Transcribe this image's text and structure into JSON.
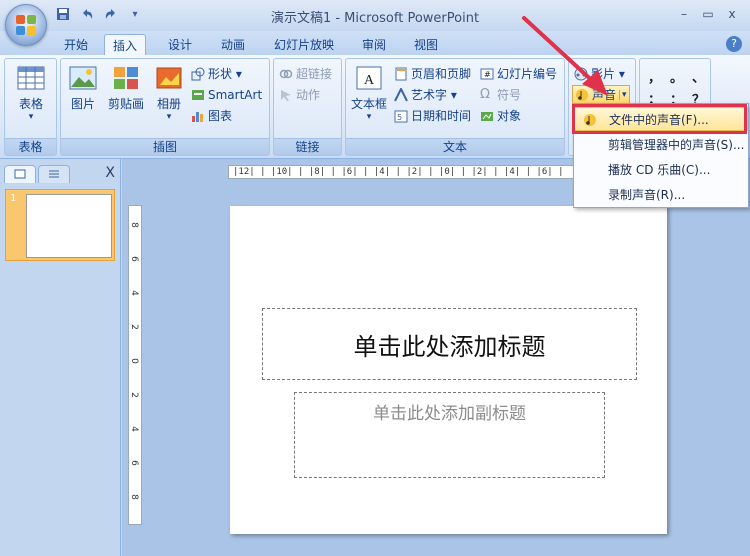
{
  "window": {
    "title": "演示文稿1 - Microsoft PowerPoint",
    "minimize": "–",
    "maximize": "▭",
    "close": "x"
  },
  "qat": {
    "save": "💾",
    "undo": "↶",
    "redo": "↷",
    "more": "▾"
  },
  "tabs": [
    "开始",
    "插入",
    "设计",
    "动画",
    "幻灯片放映",
    "审阅",
    "视图"
  ],
  "active_tab": "插入",
  "help": "?",
  "ribbon": {
    "groups": {
      "table": {
        "label": "表格",
        "button": "表格",
        "arrow": "▾"
      },
      "illustrations": {
        "label": "插图",
        "picture": "图片",
        "clipart": "剪贴画",
        "album": "相册",
        "shapes": "形状 ▾",
        "smartart": "SmartArt",
        "chart": "图表"
      },
      "links": {
        "label": "链接",
        "hyperlink": "超链接",
        "action": "动作"
      },
      "text": {
        "label": "文本",
        "textbox": "文本框",
        "header_footer": "页眉和页脚",
        "wordart": "艺术字 ▾",
        "datetime": "日期和时间",
        "slide_number": "幻灯片编号",
        "symbol": "符号",
        "object": "对象"
      },
      "media": {
        "movie": "影片 ▾",
        "sound": "声音",
        "sound_arrow": "▾"
      },
      "special_chars": [
        "，",
        "。",
        "、",
        "；",
        "：",
        "？"
      ]
    }
  },
  "sound_menu": {
    "items": [
      "文件中的声音(F)...",
      "剪辑管理器中的声音(S)...",
      "播放 CD 乐曲(C)...",
      "录制声音(R)..."
    ]
  },
  "left_pane": {
    "close": "X",
    "slide_number": "1"
  },
  "ruler": {
    "horizontal": "|12| | |10| | |8| | |6| | |4| | |2| | |0| | |2| | |4| | |6| |",
    "vertical": [
      "8",
      "6",
      "4",
      "2",
      "0",
      "2",
      "4",
      "6",
      "8"
    ]
  },
  "slide": {
    "title_placeholder": "单击此处添加标题",
    "subtitle_placeholder": "单击此处添加副标题"
  },
  "colors": {
    "accent": "#e0324b",
    "ribbon": "#dbe7f7",
    "highlight": "#ffe59a"
  }
}
